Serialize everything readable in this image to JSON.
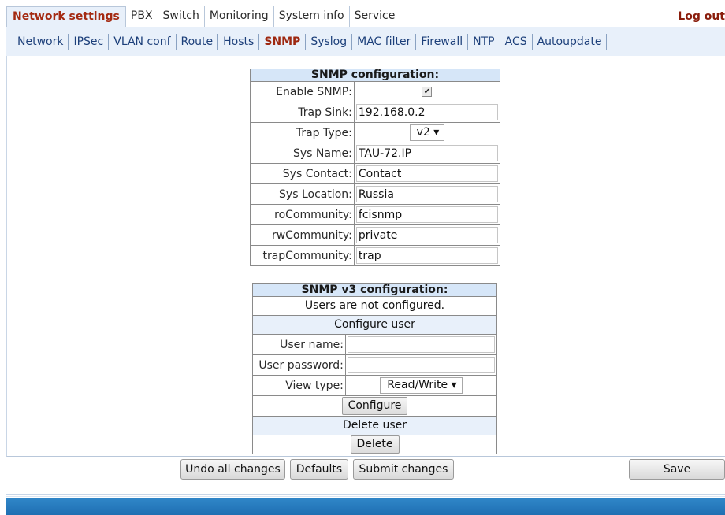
{
  "top_menu": {
    "items": [
      "Network settings",
      "PBX",
      "Switch",
      "Monitoring",
      "System info",
      "Service"
    ],
    "logout": "Log out"
  },
  "sub_menu": {
    "items": [
      "Network",
      "IPSec",
      "VLAN conf",
      "Route",
      "Hosts",
      "SNMP",
      "Syslog",
      "MAC filter",
      "Firewall",
      "NTP",
      "ACS",
      "Autoupdate"
    ]
  },
  "snmp": {
    "title": "SNMP configuration:",
    "enable_label": "Enable SNMP:",
    "enable_checked": true,
    "trap_sink_label": "Trap Sink:",
    "trap_sink": "192.168.0.2",
    "trap_type_label": "Trap Type:",
    "trap_type": "v2",
    "sys_name_label": "Sys Name:",
    "sys_name": "TAU-72.IP",
    "sys_contact_label": "Sys Contact:",
    "sys_contact": "Contact",
    "sys_location_label": "Sys Location:",
    "sys_location": "Russia",
    "ro_label": "roCommunity:",
    "ro": "fcisnmp",
    "rw_label": "rwCommunity:",
    "rw": "private",
    "trap_comm_label": "trapCommunity:",
    "trap_comm": "trap"
  },
  "snmpv3": {
    "title": "SNMP v3 configuration:",
    "users_note": "Users are not configured.",
    "configure_user_header": "Configure user",
    "user_name_label": "User name:",
    "user_name": "",
    "user_password_label": "User password:",
    "user_password": "",
    "view_type_label": "View type:",
    "view_type": "Read/Write",
    "configure_button": "Configure",
    "delete_user_header": "Delete user",
    "delete_button": "Delete"
  },
  "actions": {
    "undo": "Undo all changes",
    "defaults": "Defaults",
    "submit": "Submit changes",
    "save": "Save"
  },
  "colors": {
    "active_tab_text": "#a42a12",
    "menu_bg": "#e8f0fa",
    "table_header_bg": "#d6e6f8",
    "footer_band": "#2f86c8"
  }
}
